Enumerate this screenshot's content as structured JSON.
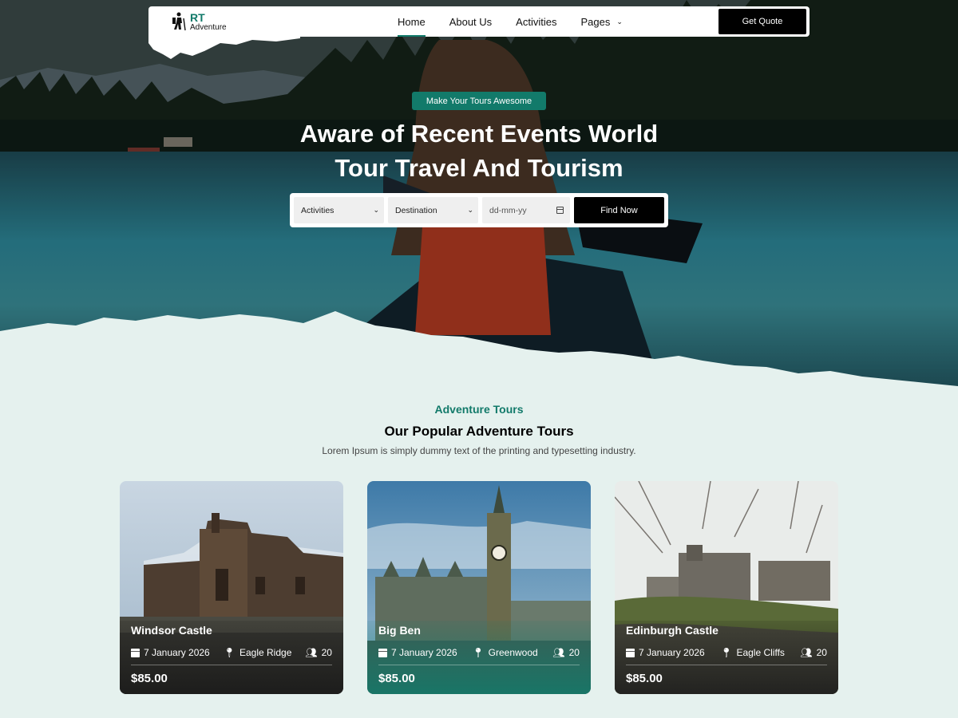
{
  "brand": {
    "name": "RT",
    "sub": "Adventure"
  },
  "nav": {
    "items": [
      {
        "label": "Home",
        "active": true
      },
      {
        "label": "About Us"
      },
      {
        "label": "Activities"
      },
      {
        "label": "Pages",
        "has_dropdown": true
      }
    ],
    "cta": "Get Quote"
  },
  "hero": {
    "tag": "Make Your Tours Awesome",
    "headline_line1": "Aware of Recent Events World",
    "headline_line2": "Tour Travel And Tourism"
  },
  "search": {
    "activities": "Activities",
    "destination": "Destination",
    "date_placeholder": "dd-mm-yy",
    "button": "Find Now"
  },
  "section": {
    "kicker": "Adventure Tours",
    "title": "Our Popular Adventure Tours",
    "description": "Lorem Ipsum is simply dummy text of the printing and typesetting industry."
  },
  "tours": [
    {
      "name": "Windsor Castle",
      "date": "7 January 2026",
      "location": "Eagle Ridge",
      "people": "20",
      "price": "$85.00"
    },
    {
      "name": "Big Ben",
      "date": "7 January 2026",
      "location": "Greenwood",
      "people": "20",
      "price": "$85.00"
    },
    {
      "name": "Edinburgh Castle",
      "date": "7 January 2026",
      "location": "Eagle Cliffs",
      "people": "20",
      "price": "$85.00"
    }
  ],
  "colors": {
    "accent": "#127a6a",
    "background": "#e5f1ee",
    "dark": "#000000"
  }
}
